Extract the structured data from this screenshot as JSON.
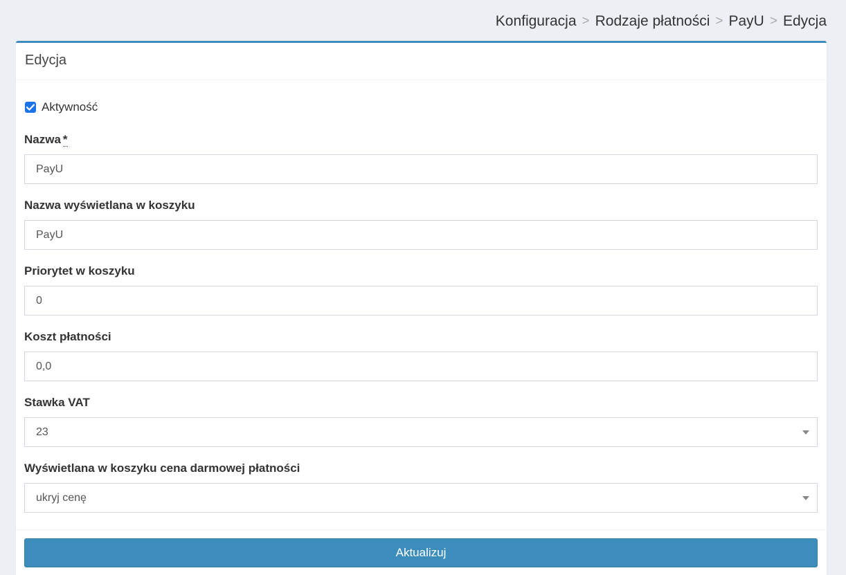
{
  "breadcrumb": {
    "items": [
      "Konfiguracja",
      "Rodzaje płatności",
      "PayU",
      "Edycja"
    ],
    "separator": ">"
  },
  "box": {
    "title": "Edycja"
  },
  "form": {
    "active": {
      "label": "Aktywność",
      "checked": true
    },
    "name": {
      "label": "Nazwa",
      "required_mark": "*",
      "value": "PayU"
    },
    "cart_name": {
      "label": "Nazwa wyświetlana w koszyku",
      "value": "PayU"
    },
    "priority": {
      "label": "Priorytet w koszyku",
      "value": "0"
    },
    "cost": {
      "label": "Koszt płatności",
      "value": "0,0"
    },
    "vat": {
      "label": "Stawka VAT",
      "value": "23"
    },
    "free_price_display": {
      "label": "Wyświetlana w koszyku cena darmowej płatności",
      "value": "ukryj cenę"
    }
  },
  "footer": {
    "submit_label": "Aktualizuj"
  },
  "colors": {
    "accent": "#3c8dbc",
    "checkbox": "#1a73e8",
    "background": "#ecf0f5"
  }
}
